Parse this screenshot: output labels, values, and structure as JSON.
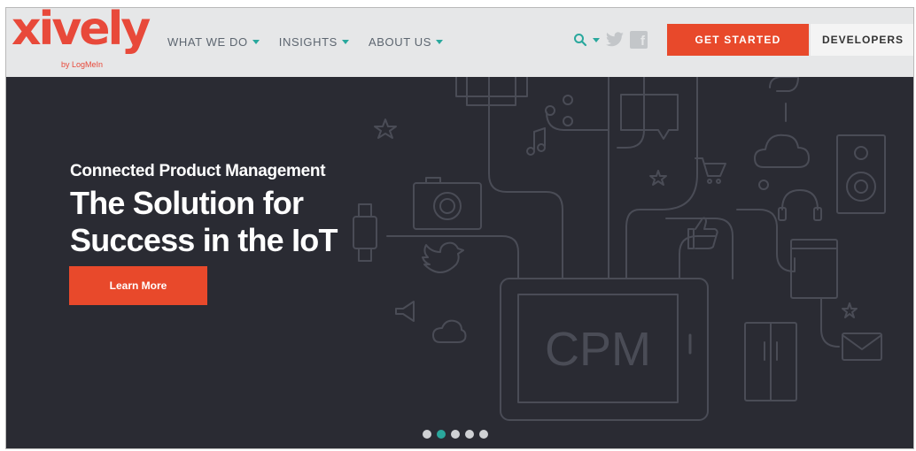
{
  "brand": {
    "logo_text": "xively",
    "logo_sub": "by LogMeIn",
    "primary_color": "#e8493a",
    "accent_color": "#29a89d"
  },
  "nav": {
    "items": [
      {
        "label": "WHAT WE DO"
      },
      {
        "label": "INSIGHTS"
      },
      {
        "label": "ABOUT US"
      }
    ]
  },
  "tools": {
    "icons": [
      "search-icon",
      "chevron-down-icon",
      "twitter-icon",
      "facebook-icon"
    ],
    "facebook_glyph": "f"
  },
  "header_buttons": {
    "get_started": "GET STARTED",
    "developers": "DEVELOPERS"
  },
  "hero": {
    "subtitle": "Connected Product Management",
    "headline_line1": "The Solution for",
    "headline_line2": "Success in the IoT",
    "cta": "Learn More",
    "art_label": "CPM",
    "background_color": "#2a2b33"
  },
  "carousel": {
    "count": 5,
    "active_index": 1
  }
}
